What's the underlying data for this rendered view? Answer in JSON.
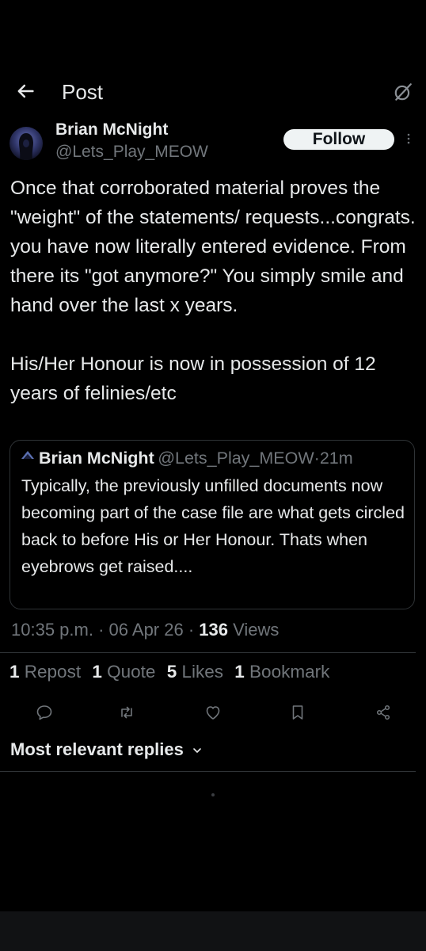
{
  "header": {
    "title": "Post"
  },
  "author": {
    "display_name": "Brian McNight",
    "handle": "@Lets_Play_MEOW",
    "follow_label": "Follow"
  },
  "post": {
    "text": "Once that corroborated material proves the \"weight\" of the statements/ requests...congrats. you have now literally entered evidence. From there its \"got anymore?\" You simply smile and hand over the last x years.\n\nHis/Her Honour is now in possession of 12 years of felinies/etc"
  },
  "quote": {
    "display_name": "Brian McNight",
    "handle": "@Lets_Play_MEOW",
    "separator": "·",
    "time": "21m",
    "text": "Typically, the previously unfilled documents now becoming part of the case file are what gets circled back to before His or Her Honour. Thats when eyebrows get raised...."
  },
  "meta": {
    "time": "10:35 p.m.",
    "date": "06 Apr 26",
    "views_count": "136",
    "views_label": "Views",
    "separator": "·"
  },
  "stats": {
    "reposts_count": "1",
    "reposts_label": "Repost",
    "quotes_count": "1",
    "quotes_label": "Quote",
    "likes_count": "5",
    "likes_label": "Likes",
    "bookmarks_count": "1",
    "bookmarks_label": "Bookmark"
  },
  "actions": [
    "reply-icon",
    "repost-icon",
    "like-icon",
    "bookmark-icon",
    "share-icon"
  ],
  "replies": {
    "filter_label": "Most relevant replies"
  },
  "colors": {
    "background": "#000000",
    "text": "#e7e9ea",
    "muted": "#71767b",
    "border": "#2f3336",
    "follow_bg": "#eff3f4"
  }
}
